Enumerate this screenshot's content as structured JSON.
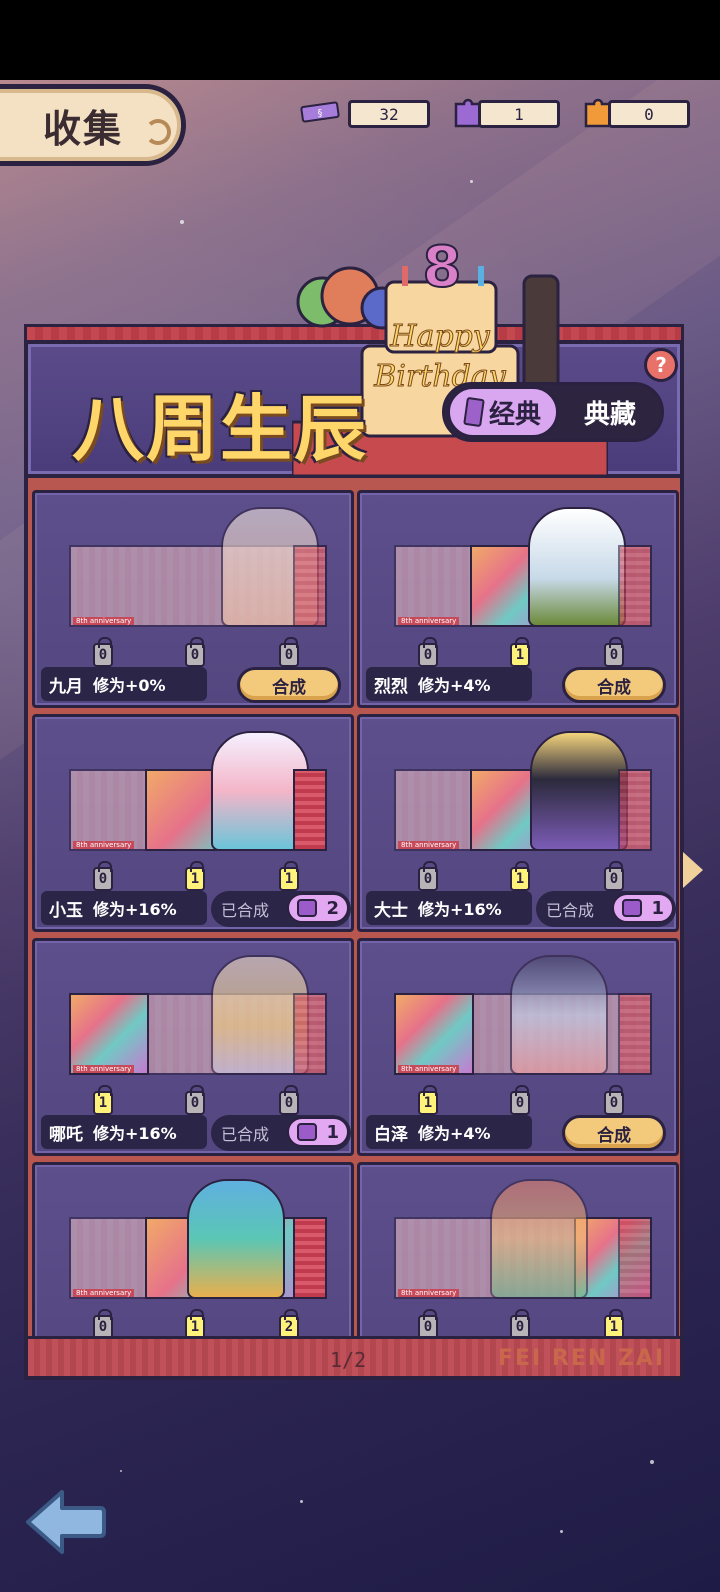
{
  "header": {
    "title": "收集"
  },
  "currencies": [
    {
      "icon": "ticket-icon",
      "value": "32"
    },
    {
      "icon": "purple-puzzle-icon",
      "value": "1"
    },
    {
      "icon": "orange-puzzle-icon",
      "value": "0"
    }
  ],
  "banner": {
    "title": "八周生辰",
    "mode_active": "经典",
    "mode_inactive": "典藏",
    "help": "?"
  },
  "cards": [
    {
      "name": "九月",
      "bonus": "修为+0%",
      "pieces": [
        "0",
        "0",
        "0"
      ],
      "status": "craft",
      "craft_label": "合成"
    },
    {
      "name": "烈烈",
      "bonus": "修为+4%",
      "pieces": [
        "0",
        "1",
        "0"
      ],
      "status": "craft",
      "craft_label": "合成"
    },
    {
      "name": "小玉",
      "bonus": "修为+16%",
      "pieces": [
        "0",
        "1",
        "1"
      ],
      "status": "crafted",
      "crafted_label": "已合成",
      "crafted_count": "2"
    },
    {
      "name": "大士",
      "bonus": "修为+16%",
      "pieces": [
        "0",
        "1",
        "0"
      ],
      "status": "crafted",
      "crafted_label": "已合成",
      "crafted_count": "1"
    },
    {
      "name": "哪吒",
      "bonus": "修为+16%",
      "pieces": [
        "1",
        "0",
        "0"
      ],
      "status": "crafted",
      "crafted_label": "已合成",
      "crafted_count": "1"
    },
    {
      "name": "白泽",
      "bonus": "修为+4%",
      "pieces": [
        "1",
        "0",
        "0"
      ],
      "status": "craft",
      "craft_label": "合成"
    },
    {
      "pieces": [
        "0",
        "1",
        "2"
      ]
    },
    {
      "pieces": [
        "0",
        "0",
        "1"
      ]
    }
  ],
  "pagination": {
    "label": "1/2"
  },
  "watermark": "FEI REN ZAI",
  "colors": {
    "craft_button": "#f3c97b",
    "crafted_badge": "#e2a8f2",
    "banner_title": "#ffd66a"
  }
}
